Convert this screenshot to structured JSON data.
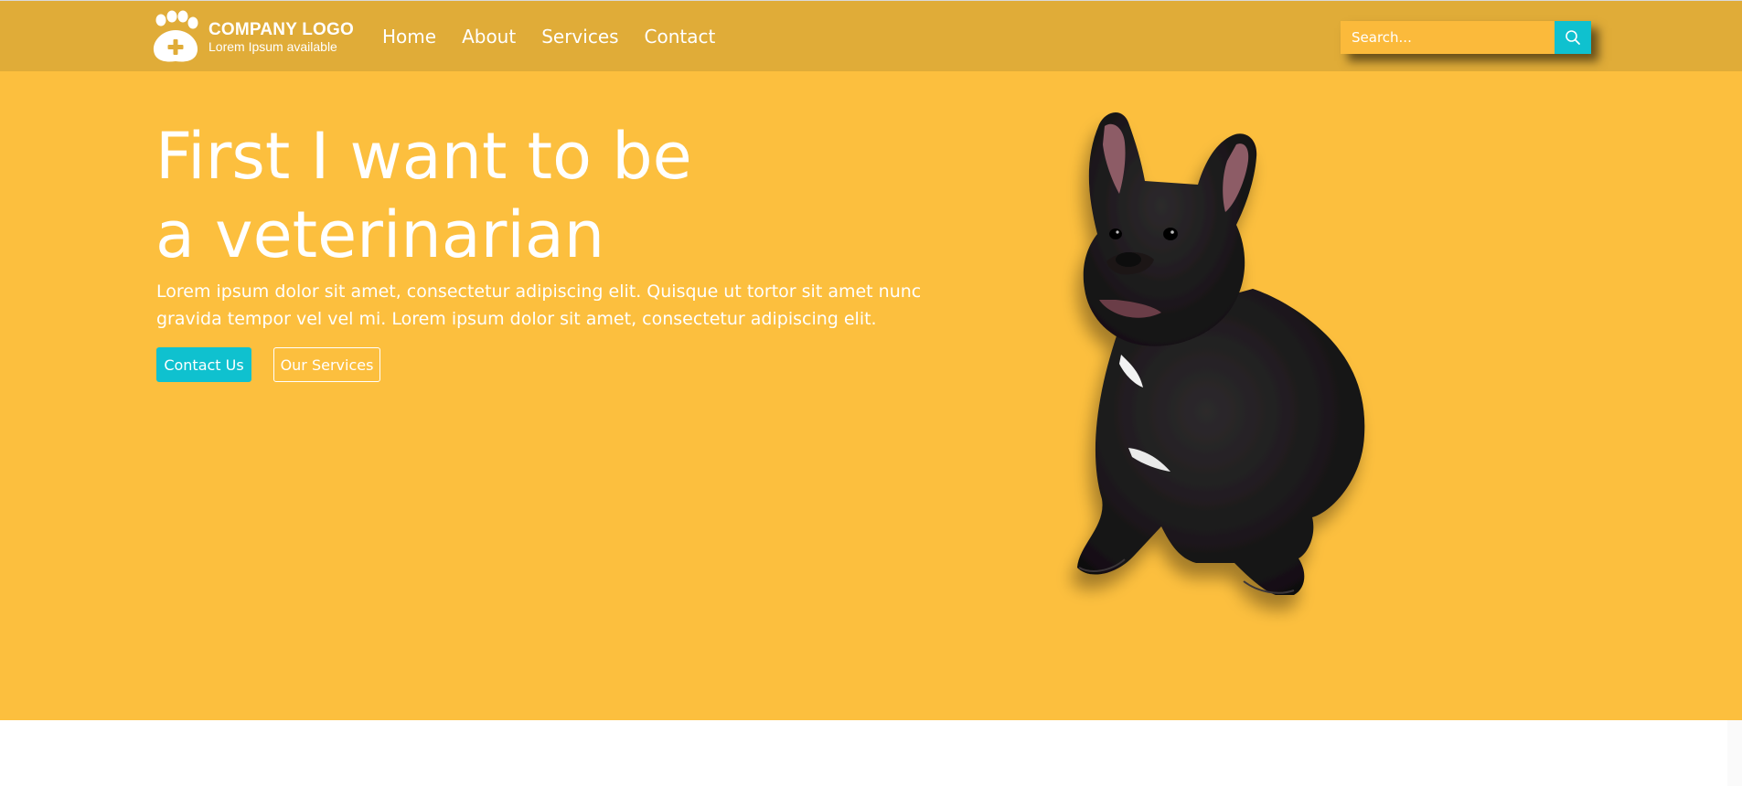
{
  "brand": {
    "title": "COMPANY LOGO",
    "subtitle": "Lorem Ipsum available",
    "icon": "paw-plus-icon"
  },
  "nav": {
    "items": [
      {
        "label": "Home"
      },
      {
        "label": "About"
      },
      {
        "label": "Services"
      },
      {
        "label": "Contact"
      }
    ]
  },
  "search": {
    "placeholder": "Search...",
    "value": "",
    "icon": "search-icon"
  },
  "hero": {
    "title_line1": "First I want to be",
    "title_line2": "a veterinarian",
    "text": "Lorem ipsum dolor sit amet, consectetur adipiscing elit. Quisque ut tortor sit amet nunc gravida tempor vel vel mi. Lorem ipsum dolor sit amet, consectetur adipiscing elit.",
    "primary_button": "Contact Us",
    "secondary_button": "Our Services",
    "image": "french-bulldog-image"
  },
  "colors": {
    "header_bg": "#e0ac38",
    "hero_bg": "#fcbf3e",
    "search_bg": "#fbba3b",
    "accent": "#0fc1cf",
    "text": "#ffffff"
  }
}
